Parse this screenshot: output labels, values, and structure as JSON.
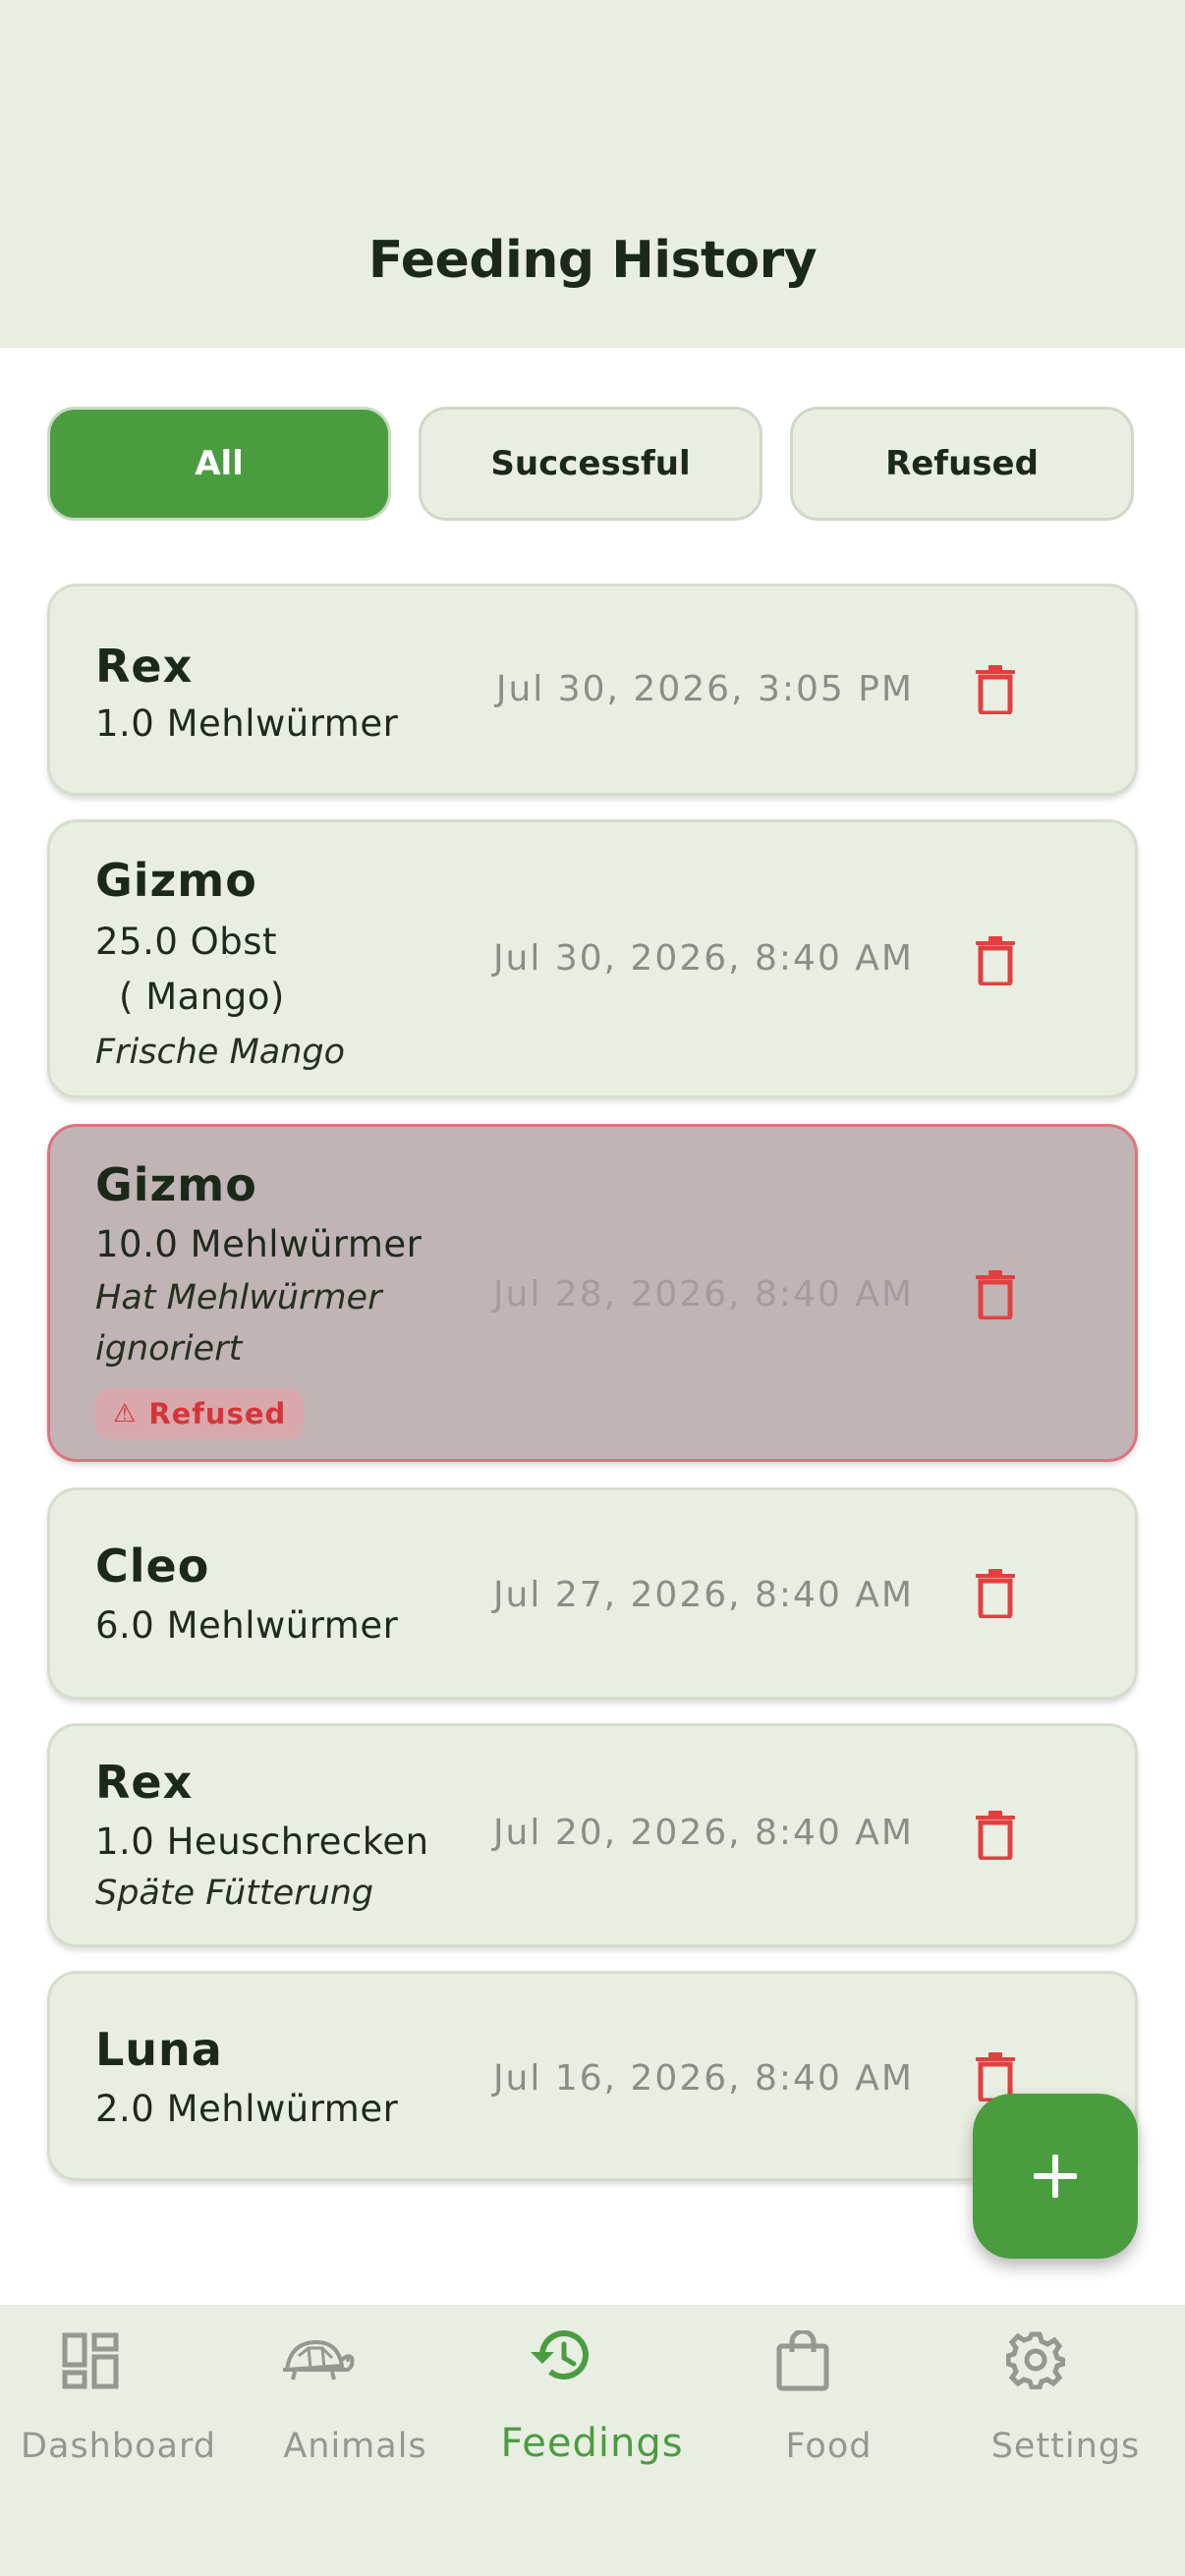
{
  "header": {
    "title": "Feeding History"
  },
  "filters": [
    {
      "label": "All",
      "active": true
    },
    {
      "label": "Successful",
      "active": false
    },
    {
      "label": "Refused",
      "active": false
    }
  ],
  "feedings": [
    {
      "name": "Rex",
      "amount": "1.0 Mehlwürmer",
      "date": "Jul 30, 2026, 3:05 PM"
    },
    {
      "name": "Gizmo",
      "amount": "25.0 Obst",
      "amount_detail": "( Mango)",
      "note": "Frische Mango",
      "date": "Jul 30, 2026, 8:40 AM"
    },
    {
      "name": "Gizmo",
      "amount": "10.0 Mehlwürmer",
      "note_line1": "Hat Mehlwürmer",
      "note_line2": "ignoriert",
      "status": "Refused",
      "date": "Jul 28, 2026, 8:40 AM"
    },
    {
      "name": "Cleo",
      "amount": "6.0 Mehlwürmer",
      "date": "Jul 27, 2026, 8:40 AM"
    },
    {
      "name": "Rex",
      "amount": "1.0 Heuschrecken",
      "note": "Späte Fütterung",
      "date": "Jul 20, 2026, 8:40 AM"
    },
    {
      "name": "Luna",
      "amount": "2.0 Mehlwürmer",
      "date": "Jul 16, 2026, 8:40 AM"
    }
  ],
  "fab": {
    "icon": "plus-icon"
  },
  "nav": [
    {
      "label": "Dashboard",
      "icon": "dashboard-icon",
      "active": false
    },
    {
      "label": "Animals",
      "icon": "turtle-icon",
      "active": false
    },
    {
      "label": "Feedings",
      "icon": "history-icon",
      "active": true
    },
    {
      "label": "Food",
      "icon": "shopping-bag-icon",
      "active": false
    },
    {
      "label": "Settings",
      "icon": "gear-icon",
      "active": false
    }
  ],
  "colors": {
    "accent": "#4a9d3f",
    "background": "#e9eee3",
    "danger": "#e2403f",
    "refused_card": "#c0b4b6"
  }
}
